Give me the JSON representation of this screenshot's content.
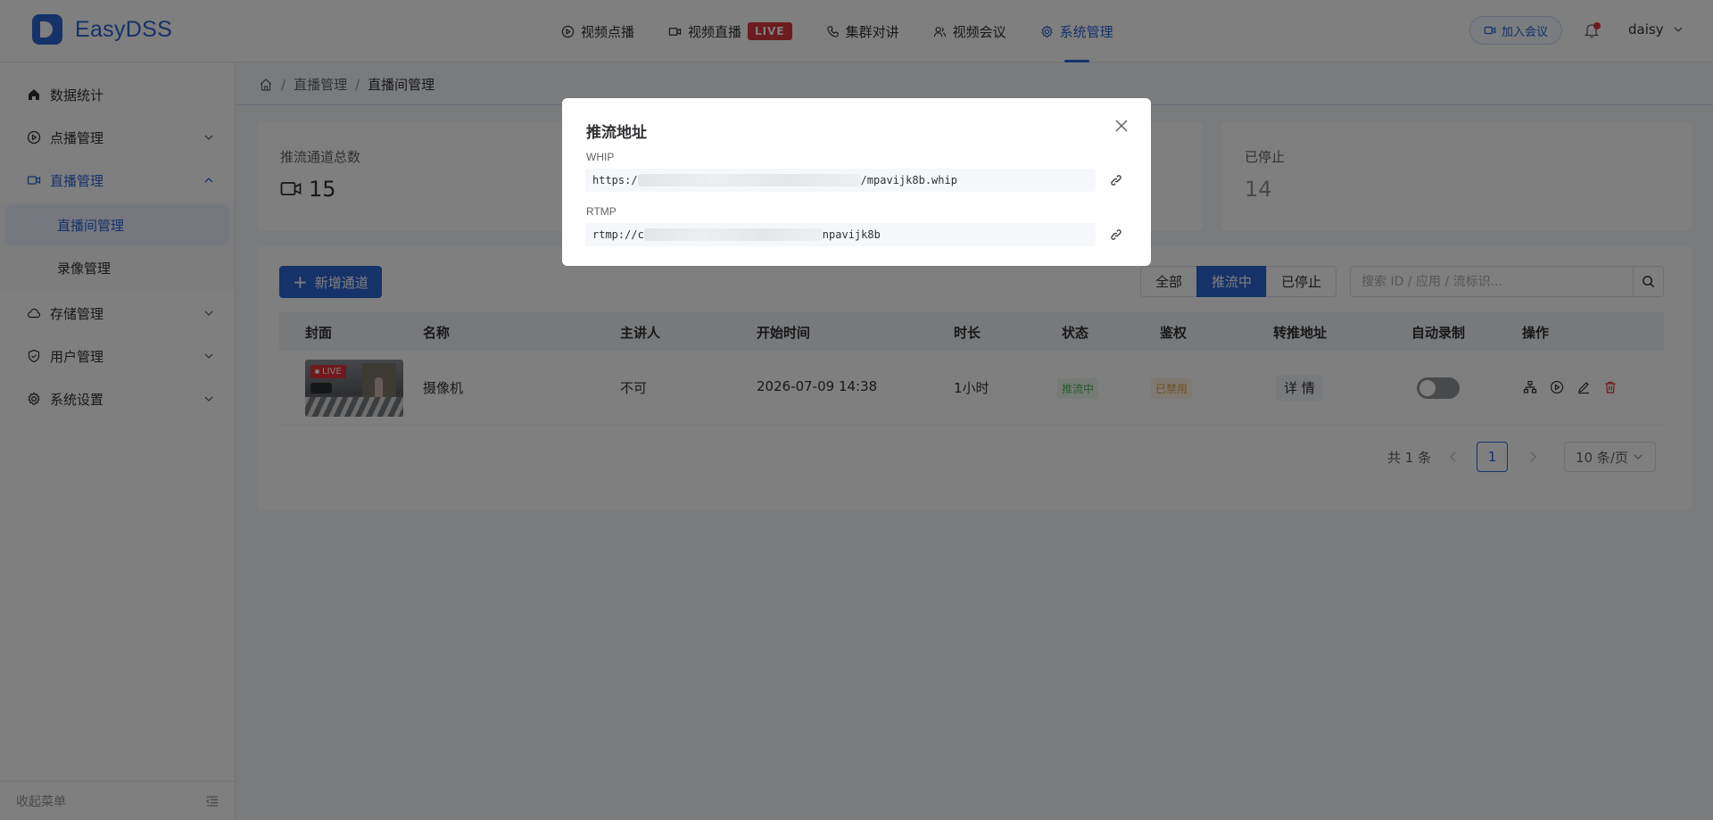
{
  "app": {
    "name": "EasyDSS",
    "brand_color": "#2a64d2"
  },
  "topnav": {
    "items": [
      {
        "label": "视频点播",
        "icon": "play-circle-icon"
      },
      {
        "label": "视频直播",
        "icon": "video-camera-icon",
        "badge": "LIVE"
      },
      {
        "label": "集群对讲",
        "icon": "phone-icon"
      },
      {
        "label": "视频会议",
        "icon": "users-icon"
      },
      {
        "label": "系统管理",
        "icon": "gear-icon",
        "active": true
      }
    ],
    "join_label": "加入会议",
    "user_name": "daisy"
  },
  "sidebar": {
    "items": [
      {
        "label": "数据统计",
        "icon": "home-icon"
      },
      {
        "label": "点播管理",
        "icon": "play-circle-icon"
      },
      {
        "label": "直播管理",
        "icon": "video-camera-icon",
        "open": true
      },
      {
        "label": "存储管理",
        "icon": "cloud-icon"
      },
      {
        "label": "用户管理",
        "icon": "shield-icon"
      },
      {
        "label": "系统设置",
        "icon": "gear-icon"
      }
    ],
    "sub_items": [
      {
        "label": "直播间管理",
        "active": true
      },
      {
        "label": "录像管理"
      }
    ],
    "collapse_label": "收起菜单"
  },
  "breadcrumb": {
    "items": [
      "直播管理",
      "直播间管理"
    ],
    "separator": "/"
  },
  "stats": [
    {
      "label": "推流通道总数",
      "value": "15"
    },
    {
      "label": "已停止",
      "value": "14"
    }
  ],
  "toolbar": {
    "add_label": "新增通道",
    "filters": [
      "全部",
      "推流中",
      "已停止"
    ],
    "active_filter": "推流中",
    "search_placeholder": "搜索 ID / 应用 / 流标识..."
  },
  "table": {
    "columns": [
      "封面",
      "名称",
      "主讲人",
      "开始时间",
      "时长",
      "状态",
      "鉴权",
      "转推地址",
      "自动录制",
      "操作"
    ],
    "rows": [
      {
        "cover_badge": "LIVE",
        "name": "摄像机",
        "presenter": "不可",
        "start_time": "2026-07-09 14:38",
        "duration": "1小时",
        "status": "推流中",
        "auth": "已禁用",
        "relay": "详 情",
        "auto_record": false
      }
    ]
  },
  "pagination": {
    "total_text": "共 1 条",
    "current_page": "1",
    "page_size": "10 条/页"
  },
  "dialog": {
    "title": "推流地址",
    "whip_label": "WHIP",
    "whip_prefix": "https:/",
    "whip_suffix": "/mpavijk8b.whip",
    "rtmp_label": "RTMP",
    "rtmp_prefix": "rtmp://c",
    "rtmp_suffix": "npavijk8b"
  }
}
